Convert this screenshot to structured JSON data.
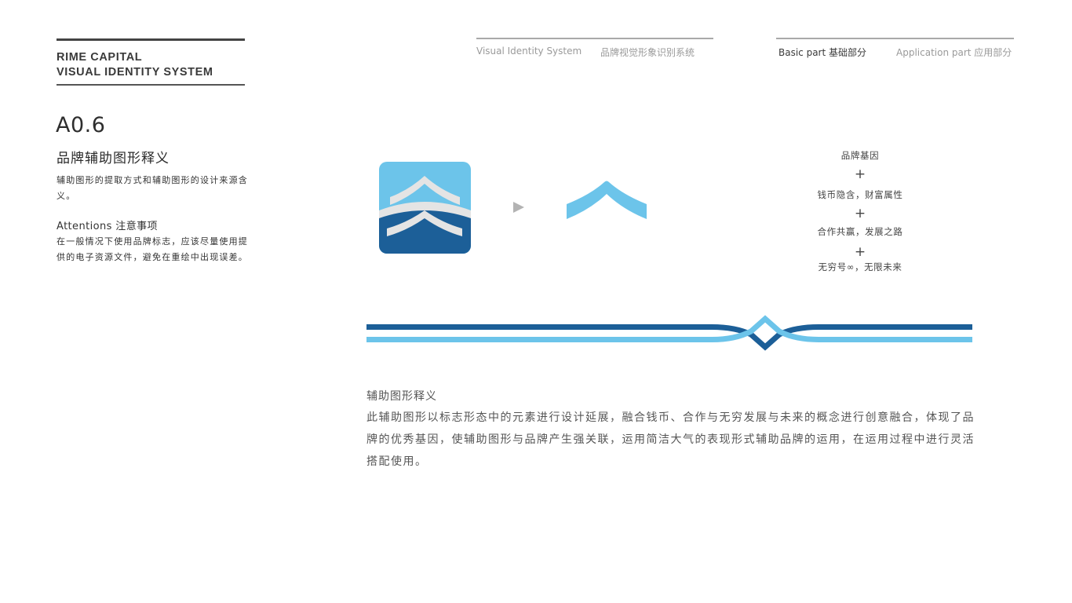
{
  "brand": {
    "line1": "RIME CAPITAL",
    "line2": "VISUAL IDENTITY SYSTEM"
  },
  "section": {
    "number": "A0.6",
    "title": "品牌辅助图形释义",
    "description": "辅助图形的提取方式和辅助图形的设计来源含义。",
    "attentions_title": "Attentions 注意事项",
    "attentions_text": "在一般情况下使用品牌标志，应该尽量使用提供的电子资源文件，避免在重绘中出现误差。"
  },
  "nav": {
    "visual_en": "Visual Identity System",
    "visual_cn": "品牌视觉形象识别系统",
    "basic_part": "Basic part  基础部分",
    "application_part": "Application part  应用部分",
    "active": "basic_part"
  },
  "colors": {
    "light_blue": "#6cc4ea",
    "dark_blue": "#1c5f98",
    "light_gray": "#e4e4e4",
    "arrow_gray": "#b3b3b3"
  },
  "icons": {
    "logo": "rime-capital-logo-icon",
    "arrow": "play-arrow-icon",
    "chevron": "chevron-graphic-icon",
    "band": "auxiliary-band-graphic"
  },
  "gene": {
    "title": "品牌基因",
    "plus": "+",
    "items": [
      "钱币隐含，财富属性",
      "合作共赢，发展之路",
      "无穷号∞，无限未来"
    ]
  },
  "explanation": {
    "title": "辅助图形释义",
    "body": "此辅助图形以标志形态中的元素进行设计延展，融合钱币、合作与无穷发展与未来的概念进行创意融合，体现了品牌的优秀基因，使辅助图形与品牌产生强关联，运用简洁大气的表现形式辅助品牌的运用，在运用过程中进行灵活搭配使用。"
  }
}
